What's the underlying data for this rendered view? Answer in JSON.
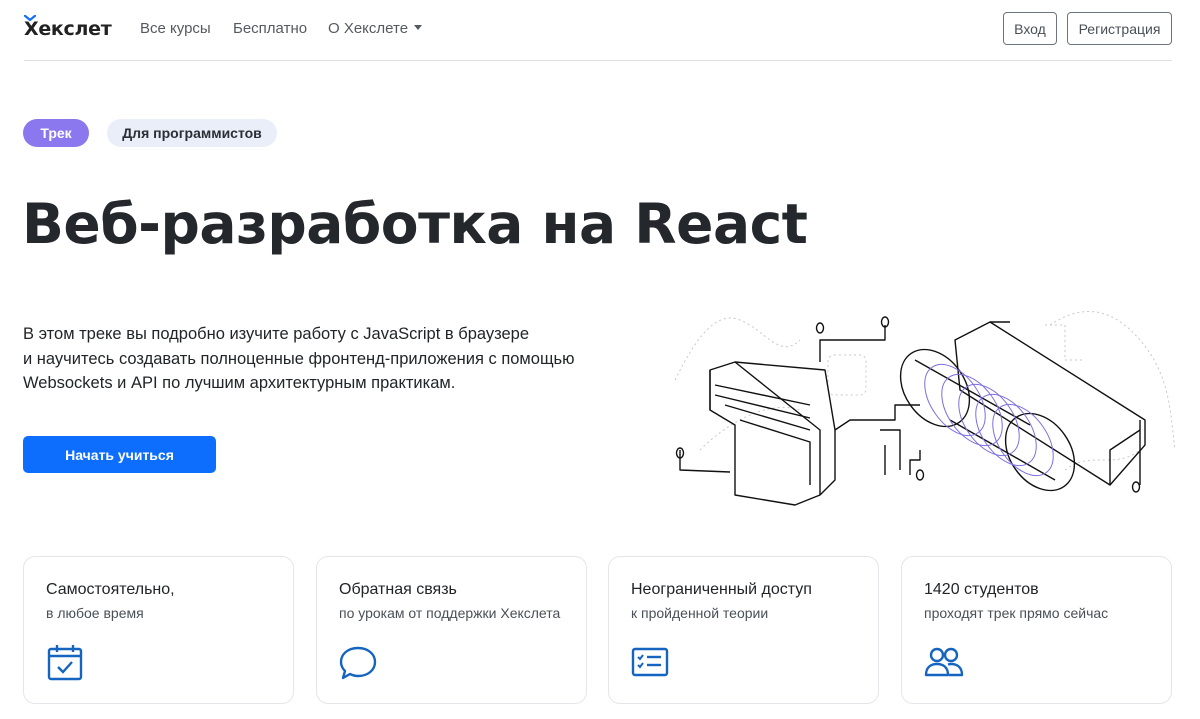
{
  "header": {
    "logo": "Хекслет",
    "nav": [
      "Все курсы",
      "Бесплатно",
      "О Хекслете"
    ],
    "login": "Вход",
    "register": "Регистрация"
  },
  "hero": {
    "badges": [
      "Трек",
      "Для программистов"
    ],
    "title": "Веб-разработка на React",
    "description": [
      "В этом треке вы подробно изучите работу с JavaScript в браузере",
      "и научитесь создавать полноценные фронтенд-приложения с помощью",
      "Websockets и API по лучшим архитектурным практикам."
    ],
    "cta": "Начать учиться"
  },
  "features": [
    {
      "title": "Самостоятельно,",
      "subtitle": "в любое время",
      "icon": "calendar-check-icon"
    },
    {
      "title": "Обратная связь",
      "subtitle": "по урокам от поддержки Хекслета",
      "icon": "chat-bubble-icon"
    },
    {
      "title": "Неограниченный доступ",
      "subtitle": "к пройденной теории",
      "icon": "checklist-icon"
    },
    {
      "title": "1420 студентов",
      "subtitle": "проходят трек прямо сейчас",
      "icon": "people-icon"
    }
  ],
  "colors": {
    "primary": "#0d6efd",
    "track_badge": "#8b78ef",
    "secondary_badge": "#e9eef8",
    "icon_blue": "#1565c0"
  }
}
